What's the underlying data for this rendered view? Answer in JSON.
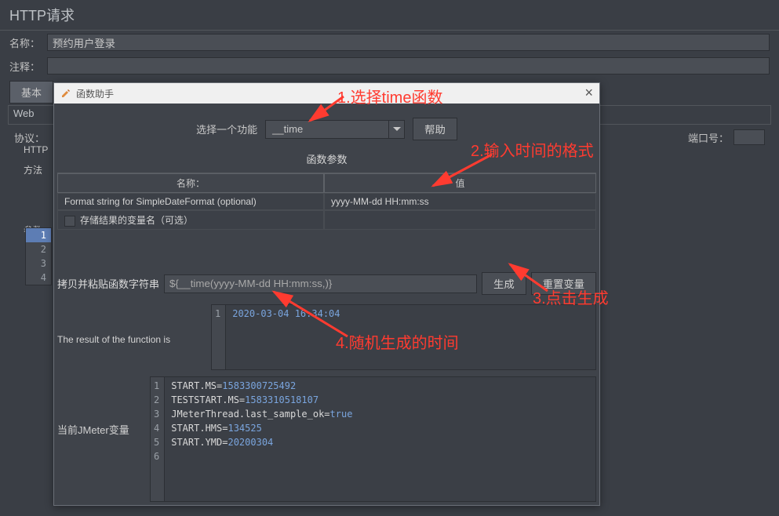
{
  "panel": {
    "title": "HTTP请求",
    "name_label": "名称：",
    "name_value": "预约用户登录",
    "comment_label": "注释：",
    "comment_value": "",
    "tab_basic": "基本",
    "sub_web": "Web",
    "protocol_label": "协议：",
    "port_label": "端口号：",
    "sub_http": "HTTP",
    "method_label": "方法",
    "params_label": "参数"
  },
  "dialog": {
    "title": "函数助手",
    "select_label": "选择一个功能",
    "select_value": "__time",
    "help_btn": "帮助",
    "params_header": "函数参数",
    "col_name": "名称：",
    "col_value": "值",
    "row1_name": "Format string for SimpleDateFormat (optional)",
    "row1_value": "yyyy-MM-dd HH:mm:ss",
    "row2_name": "存储结果的变量名（可选）",
    "row2_value": "",
    "paste_label": "拷贝并粘贴函数字符串",
    "fn_string": "${__time(yyyy-MM-dd HH:mm:ss,)}",
    "generate_btn": "生成",
    "reset_btn": "重置变量",
    "result_label": "The result of the function is",
    "result_value": "2020-03-04 16:34:04",
    "vars_label": "当前JMeter变量",
    "vars": [
      {
        "k": "START.MS",
        "v": "1583300725492"
      },
      {
        "k": "TESTSTART.MS",
        "v": "1583310518107"
      },
      {
        "k": "JMeterThread.last_sample_ok",
        "v": "true",
        "bool": true
      },
      {
        "k": "START.HMS",
        "v": "134525"
      },
      {
        "k": "START.YMD",
        "v": "20200304"
      }
    ]
  },
  "annotations": {
    "a1": "1.选择time函数",
    "a2": "2.输入时间的格式",
    "a3": "3.点击生成",
    "a4": "4.随机生成的时间"
  }
}
